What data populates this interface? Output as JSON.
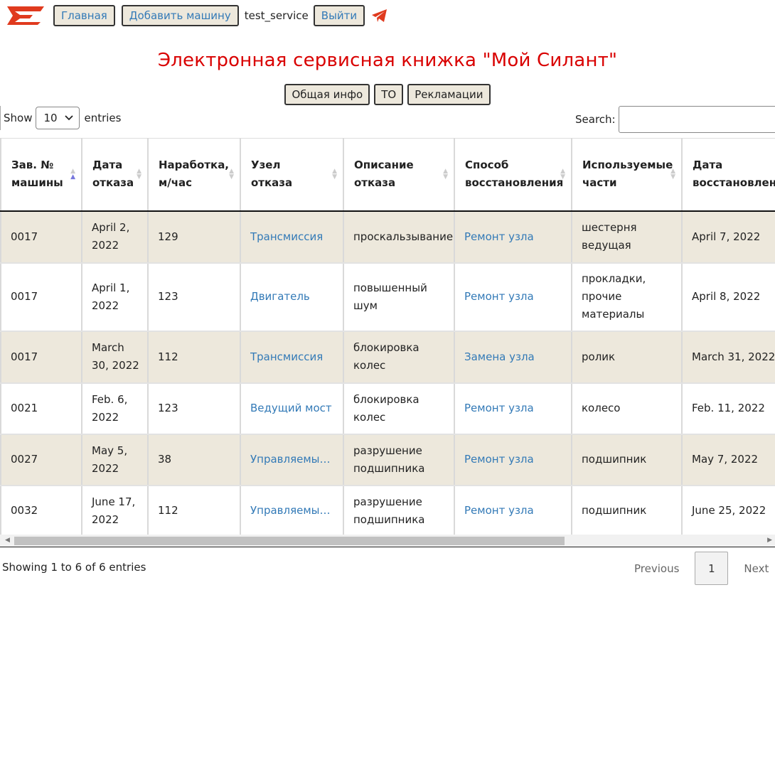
{
  "nav": {
    "logo_icon": "silant-logo",
    "home": "Главная",
    "add_machine": "Добавить машину",
    "user": "test_service",
    "logout": "Выйти",
    "telegram_icon": "telegram-icon"
  },
  "page_title": "Электронная сервисная книжка \"Мой Силант\"",
  "tabs": [
    "Общая инфо",
    "ТО",
    "Рекламации"
  ],
  "table_controls": {
    "show_label": "Show",
    "entries_value": "10",
    "entries_label": "entries",
    "search_label": "Search:",
    "search_value": ""
  },
  "table": {
    "columns": [
      "Зав. № машины",
      "Дата отказа",
      "Наработка, м/час",
      "Узел отказа",
      "Описание отказа",
      "Способ восстановления",
      "Используемые части",
      "Дата восстановления"
    ],
    "sorted_column": "Зав. № машины",
    "rows": [
      [
        "0017",
        "April 2, 2022",
        "129",
        "Трансмиссия",
        "проскальзывание",
        "Ремонт узла",
        "шестерня ведущая",
        "April 7, 2022"
      ],
      [
        "0017",
        "April 1, 2022",
        "123",
        "Двигатель",
        "повышенный шум",
        "Ремонт узла",
        "прокладки, прочие материалы",
        "April 8, 2022"
      ],
      [
        "0017",
        "March 30, 2022",
        "112",
        "Трансмиссия",
        "блокировка колес",
        "Замена узла",
        "ролик",
        "March 31, 2022"
      ],
      [
        "0021",
        "Feb. 6, 2022",
        "123",
        "Ведущий мост",
        "блокировка колес",
        "Ремонт узла",
        "колесо",
        "Feb. 11, 2022"
      ],
      [
        "0027",
        "May 5, 2022",
        "38",
        "Управляемый…",
        "разрушение подшипника",
        "Ремонт узла",
        "подшипник",
        "May 7, 2022"
      ],
      [
        "0032",
        "June 17, 2022",
        "112",
        "Управляемый…",
        "разрушение подшипника",
        "Ремонт узла",
        "подшипник",
        "June 25, 2022"
      ]
    ]
  },
  "footer": {
    "info": "Showing 1 to 6 of 6 entries",
    "previous": "Previous",
    "current_page": "1",
    "next": "Next"
  },
  "colors": {
    "accent_red": "#d90000",
    "link": "#337ab7",
    "row_stripe": "#ede8dc"
  }
}
